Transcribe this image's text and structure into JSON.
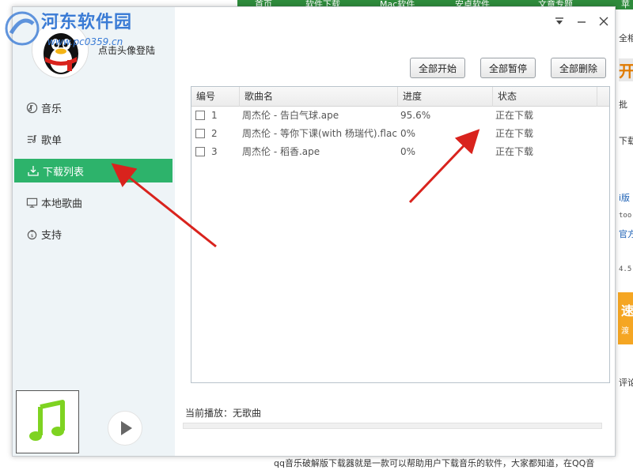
{
  "background": {
    "nav_items": [
      "首页",
      "软件下载",
      "Mac软件",
      "安卓软件",
      "文章专题",
      "苹果"
    ],
    "right_snippets": [
      "全相",
      "开",
      "批",
      "下载",
      "i版",
      "too",
      "官方",
      "4.5",
      "速",
      "渡",
      "评论"
    ],
    "bottom_text": "qq音乐破解版下载器就是一款可以帮助用户下载音乐的软件，大家都知道，在QQ音"
  },
  "watermark": {
    "title": "河东软件园",
    "url": "www.pc0359.cn"
  },
  "sidebar": {
    "login_text": "点击头像登陆",
    "items": [
      {
        "label": "音乐",
        "icon": "music-icon"
      },
      {
        "label": "歌单",
        "icon": "playlist-icon"
      },
      {
        "label": "下载列表",
        "icon": "download-icon",
        "active": true
      },
      {
        "label": "本地歌曲",
        "icon": "monitor-icon"
      },
      {
        "label": "支持",
        "icon": "support-icon"
      }
    ]
  },
  "toolbar": {
    "start_all": "全部开始",
    "pause_all": "全部暂停",
    "delete_all": "全部删除"
  },
  "table": {
    "headers": [
      "编号",
      "歌曲名",
      "进度",
      "状态"
    ],
    "rows": [
      {
        "no": "1",
        "name": "周杰伦 - 告白气球.ape",
        "progress": "95.6%",
        "status": "正在下载"
      },
      {
        "no": "2",
        "name": "周杰伦 - 等你下课(with 杨瑞代).flac",
        "progress": "0%",
        "status": "正在下载"
      },
      {
        "no": "3",
        "name": "周杰伦 - 稻香.ape",
        "progress": "0%",
        "status": "正在下载"
      }
    ]
  },
  "player": {
    "now_playing": "当前播放：无歌曲"
  },
  "colors": {
    "accent": "#2db36b",
    "arrow": "#d9231d"
  }
}
